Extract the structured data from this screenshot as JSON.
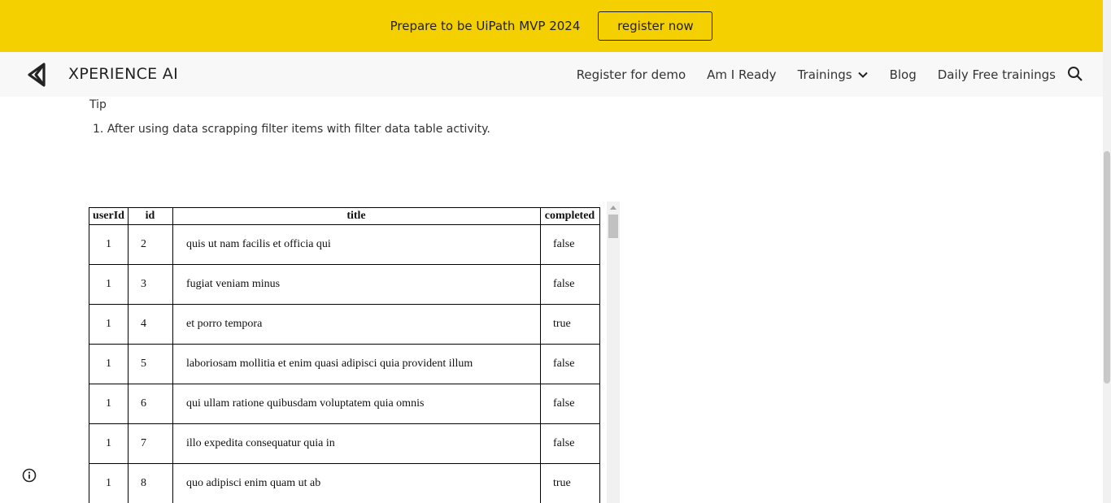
{
  "promo": {
    "text": "Prepare to be UiPath MVP 2024",
    "button_label": "register now",
    "bg_color": "#f5d000"
  },
  "nav": {
    "brand": "XPERIENCE AI",
    "logo_icon": "triangle-logo-icon",
    "links": [
      {
        "label": "Register for demo"
      },
      {
        "label": "Am I Ready"
      },
      {
        "label": "Trainings",
        "has_dropdown": true
      },
      {
        "label": "Blog"
      },
      {
        "label": "Daily Free trainings"
      }
    ],
    "search_icon": "search-icon"
  },
  "content": {
    "tip_heading": "Tip",
    "tip_item_number": "1.",
    "tip_item": "After using data scrapping filter items with filter data table activity."
  },
  "table": {
    "headers": [
      "userId",
      "id",
      "title",
      "completed"
    ],
    "rows": [
      [
        "1",
        "2",
        "quis ut nam facilis et officia qui",
        "false"
      ],
      [
        "1",
        "3",
        "fugiat veniam minus",
        "false"
      ],
      [
        "1",
        "4",
        "et porro tempora",
        "true"
      ],
      [
        "1",
        "5",
        "laboriosam mollitia et enim quasi adipisci quia provident illum",
        "false"
      ],
      [
        "1",
        "6",
        "qui ullam ratione quibusdam voluptatem quia omnis",
        "false"
      ],
      [
        "1",
        "7",
        "illo expedita consequatur quia in",
        "false"
      ],
      [
        "1",
        "8",
        "quo adipisci enim quam ut ab",
        "true"
      ]
    ]
  },
  "footer": {
    "info_icon": "info-icon"
  }
}
